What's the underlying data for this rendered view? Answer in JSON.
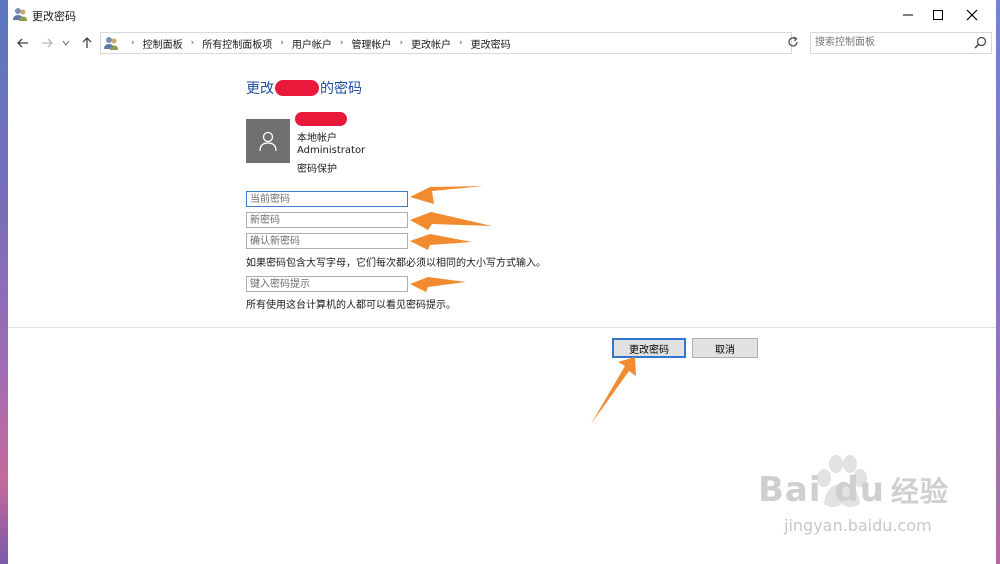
{
  "window": {
    "title": "更改密码"
  },
  "address": {
    "breadcrumbs": [
      "控制面板",
      "所有控制面板项",
      "用户帐户",
      "管理帐户",
      "更改帐户",
      "更改密码"
    ],
    "search_placeholder": "搜索控制面板"
  },
  "content": {
    "title_prefix": "更改",
    "title_suffix": "的密码",
    "account": {
      "type": "本地帐户",
      "group": "Administrator",
      "status": "密码保护"
    },
    "fields": {
      "current_password_placeholder": "当前密码",
      "new_password_placeholder": "新密码",
      "confirm_password_placeholder": "确认新密码",
      "hint_placeholder": "键入密码提示"
    },
    "case_note": "如果密码包含大写字母，它们每次都必须以相同的大小写方式输入。",
    "hint_note": "所有使用这台计算机的人都可以看见密码提示。"
  },
  "buttons": {
    "change_password": "更改密码",
    "cancel": "取消"
  },
  "watermark": {
    "brand": "Bai",
    "brand2": "du",
    "brand_cn": "经验",
    "url": "jingyan.baidu.com"
  },
  "colors": {
    "title_blue": "#1c4ea0",
    "annotation_orange": "#f28a30",
    "redaction_red": "#e8193a",
    "focus_blue": "#3278d0"
  }
}
